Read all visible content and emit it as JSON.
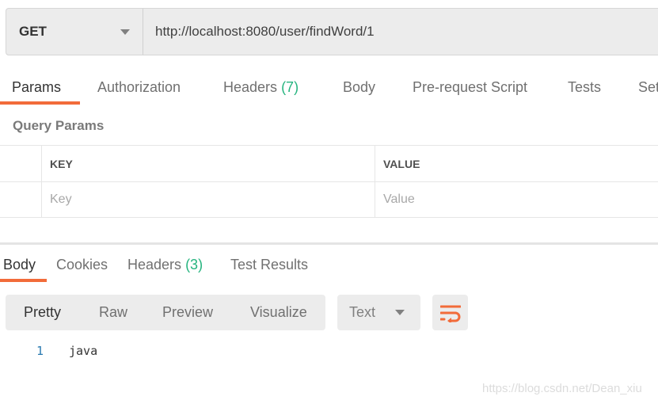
{
  "request": {
    "method": "GET",
    "url": "http://localhost:8080/user/findWord/1"
  },
  "request_tabs": [
    {
      "label": "Params",
      "count": null,
      "active": true
    },
    {
      "label": "Authorization",
      "count": null,
      "active": false
    },
    {
      "label": "Headers",
      "count": "(7)",
      "active": false
    },
    {
      "label": "Body",
      "count": null,
      "active": false
    },
    {
      "label": "Pre-request Script",
      "count": null,
      "active": false
    },
    {
      "label": "Tests",
      "count": null,
      "active": false
    },
    {
      "label": "Set",
      "count": null,
      "active": false
    }
  ],
  "query_params": {
    "title": "Query Params",
    "columns": [
      "KEY",
      "VALUE"
    ],
    "placeholder_row": {
      "key": "Key",
      "value": "Value"
    }
  },
  "response_tabs": [
    {
      "label": "Body",
      "count": null,
      "active": true
    },
    {
      "label": "Cookies",
      "count": null,
      "active": false
    },
    {
      "label": "Headers",
      "count": "(3)",
      "active": false
    },
    {
      "label": "Test Results",
      "count": null,
      "active": false
    }
  ],
  "view_modes": [
    {
      "label": "Pretty",
      "active": true
    },
    {
      "label": "Raw",
      "active": false
    },
    {
      "label": "Preview",
      "active": false
    },
    {
      "label": "Visualize",
      "active": false
    }
  ],
  "format": {
    "selected": "Text"
  },
  "wrap_icon": "wrap-lines-icon",
  "response_body": {
    "lines": [
      {
        "number": "1",
        "text": "java"
      }
    ]
  },
  "watermark": "https://blog.csdn.net/Dean_xiu",
  "colors": {
    "accent": "#f26b3a",
    "count": "#26b47f",
    "line_number": "#2a7ab0"
  }
}
